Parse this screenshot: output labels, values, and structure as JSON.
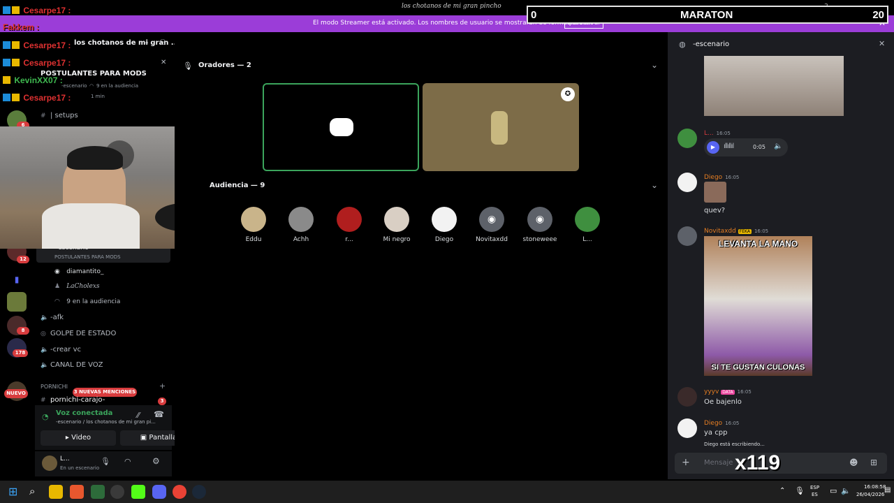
{
  "window": {
    "title": "los chotanos de mi gran pincho"
  },
  "streamer_banner": {
    "text": "El modo Streamer está activado. Los nombres de usuario se mostrarán de forma parcial.",
    "button": "Desactivar"
  },
  "maraton": {
    "left": "0",
    "title": "MARATON",
    "right": "20"
  },
  "chat_overlay": [
    {
      "user": "Cesarpe17 :",
      "color": "red"
    },
    {
      "user": "Fakkem :",
      "color": "red"
    },
    {
      "user": "Cesarpe17 :",
      "color": "red"
    },
    {
      "user": "Cesarpe17 :",
      "color": "red"
    },
    {
      "user": "KevinXX07 :",
      "color": "green"
    },
    {
      "user": "Cesarpe17 :",
      "color": "red"
    }
  ],
  "rail": {
    "badges": [
      "6",
      "12",
      "8",
      "178"
    ],
    "new_label": "NUEVO",
    "mentions_label": "3 NUEVAS MENCIONES"
  },
  "server_header": {
    "name": "los chotanos de mi gran ..."
  },
  "stage_popup": {
    "title": "POSTULANTES PARA MODS",
    "channel": "-escenario",
    "audience": "9 en la audiencia",
    "time": "1 min"
  },
  "sidebar": {
    "setups": "| setups",
    "stage_channel": "-escenario",
    "stage_topic": "POSTULANTES PARA MODS",
    "speakers": [
      "diamantito_",
      "LaCholexs"
    ],
    "audience": "9 en la audiencia",
    "channels": [
      "-afk",
      "GOLPE DE ESTADO",
      "-crear vc",
      "CANAL DE VOZ"
    ],
    "category": "PORNICHI",
    "last_channel": "pornichi-carajo-",
    "last_badge": "3"
  },
  "voice": {
    "status": "Voz conectada",
    "location": "-escenario / los chotanos de mi gran pi...",
    "video_btn": "Video",
    "screen_btn": "Pantalla"
  },
  "user_panel": {
    "name": "L...",
    "status": "En un escenario"
  },
  "stage": {
    "speakers_heading": "Oradores — 2",
    "audience_heading": "Audiencia — 9",
    "audience": [
      "Eddu",
      "Achh",
      "r...",
      "Mi negro",
      "Diego",
      "Novitaxdd",
      "stoneweee",
      "L..."
    ]
  },
  "chat": {
    "channel": "-escenario",
    "messages": [
      {
        "name": "L...",
        "time": "16:05",
        "audio_time": "0:05"
      },
      {
        "name": "Diego",
        "time": "16:05",
        "text": "quev?"
      },
      {
        "name": "Novitaxdd",
        "tag": "FEKA",
        "time": "16:05",
        "meme_top": "LEVANTA LA MANO",
        "meme_bottom": "SI TE GUSTAN CULONAS"
      },
      {
        "name": "yyyv",
        "tag": "DATA",
        "time": "16:05",
        "text": "Oe bajenlo"
      },
      {
        "name": "Diego",
        "time": "16:05",
        "text": "ya cpp"
      }
    ],
    "typing": "Diego está escribiendo...",
    "input_placeholder": "Mensaje",
    "overlay_counter": "x119"
  },
  "taskbar": {
    "lang_top": "ESP",
    "lang_bottom": "ES",
    "time": "16:08:58",
    "date": "26/04/2026"
  },
  "colors": {
    "discord_blurple": "#5865f2",
    "speaking_green": "#3ba55c",
    "banner_purple": "#9b3dd8",
    "name_orange": "#e67e22"
  }
}
